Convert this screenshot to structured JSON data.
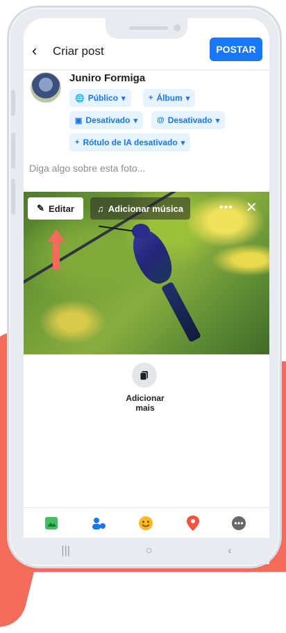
{
  "header": {
    "title": "Criar post",
    "post_label": "POSTAR"
  },
  "user": {
    "name": "Juniro Formiga"
  },
  "chips": {
    "audience": "Público",
    "album": "Álbum",
    "instagram": "Desativado",
    "threads": "Desativado",
    "ai_label": "Rótulo de IA desativado"
  },
  "caption": {
    "placeholder": "Diga algo sobre esta foto..."
  },
  "photo_actions": {
    "edit": "Editar",
    "music": "Adicionar música"
  },
  "add_more": {
    "label_line1": "Adicionar",
    "label_line2": "mais"
  },
  "colors": {
    "accent": "#1877f2",
    "chip_bg": "#e7f3ff",
    "highlight_arrow": "#f26b5b"
  },
  "toolbar_icons": [
    "photo-icon",
    "tag-people-icon",
    "feeling-icon",
    "location-icon",
    "more-options-icon"
  ]
}
